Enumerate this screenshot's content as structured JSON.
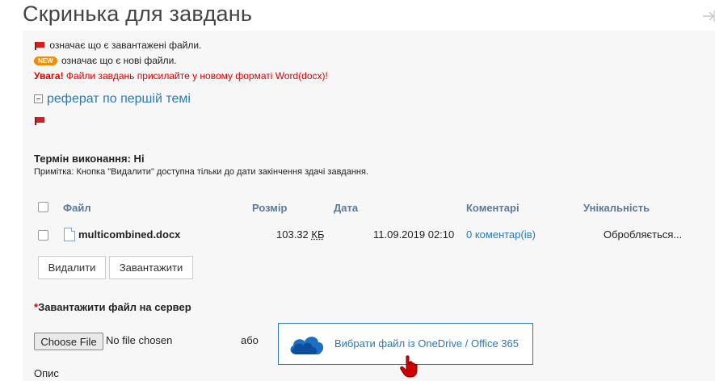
{
  "page": {
    "title": "Скринька для завдань"
  },
  "legend": {
    "uploaded_text": "означає що є завантажені файли.",
    "new_badge": "NEW",
    "new_text": "означає що є нові файли.",
    "warning_bold": "Увага!",
    "warning_text": "Файли завдань присилайте у новому форматі Word(docx)!"
  },
  "topic": {
    "title": "реферат по першій темі"
  },
  "deadline": {
    "label": "Термін виконання: Ні",
    "note": "Примітка: Кнопка \"Видалити\" доступна тільки до дати закінчення здачі завдання."
  },
  "table": {
    "headers": {
      "file": "Файл",
      "size": "Розмір",
      "date": "Дата",
      "comments": "Коментарі",
      "uniqueness": "Унікальність"
    },
    "rows": [
      {
        "file": "multicombined.docx",
        "size": "103.32",
        "size_unit": "КБ",
        "date": "11.09.2019 02:10",
        "comments": "0 коментар(ів)",
        "uniqueness": "Обробляється..."
      }
    ]
  },
  "buttons": {
    "delete": "Видалити",
    "download": "Завантажити"
  },
  "upload": {
    "required_mark": "*",
    "heading": "Завантажити файл на сервер",
    "choose_file": "Choose File",
    "no_file": "No file chosen",
    "or": "або",
    "onedrive": "Вибрати файл із OneDrive / Office 365",
    "description_label": "Опис"
  },
  "colors": {
    "link": "#2a7ab8",
    "warning": "#e00000",
    "header": "#5a7a9a",
    "badge": "#f28c00"
  }
}
